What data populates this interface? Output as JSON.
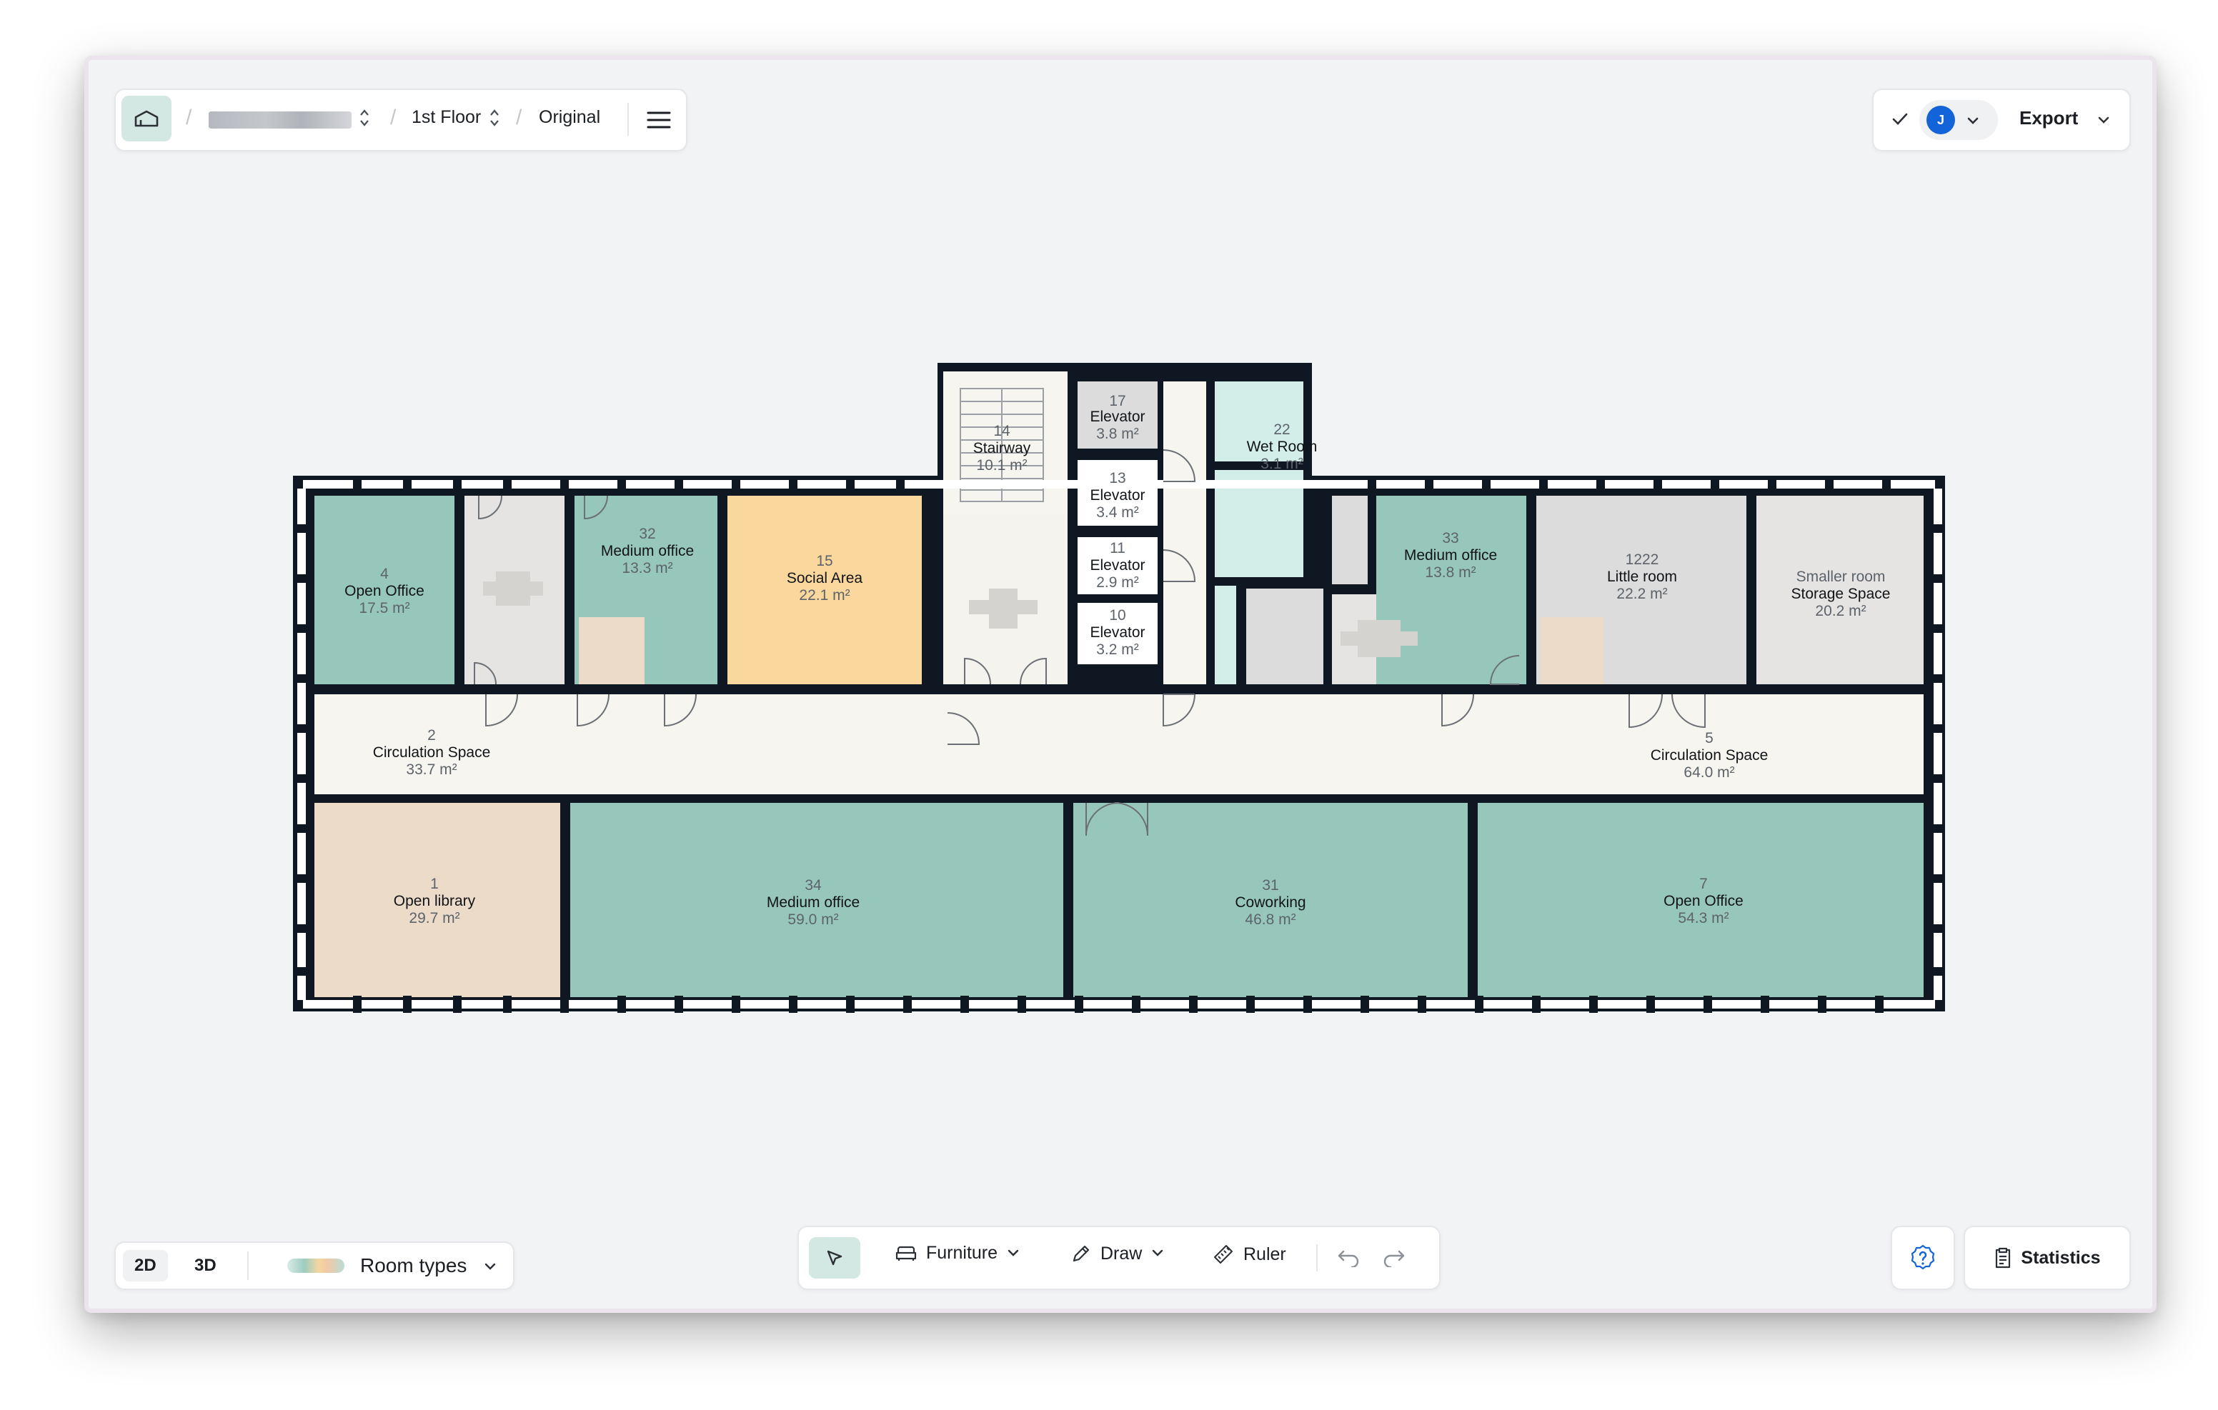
{
  "header": {
    "floor": "1st Floor",
    "version": "Original"
  },
  "account": {
    "avatar_initial": "J",
    "export_label": "Export"
  },
  "view": {
    "mode_2d": "2D",
    "mode_3d": "3D",
    "active_mode": "2D",
    "legend_label": "Room types"
  },
  "toolbar": {
    "furniture_label": "Furniture",
    "draw_label": "Draw",
    "ruler_label": "Ruler"
  },
  "statistics_label": "Statistics",
  "colors": {
    "office": "#97c7bb",
    "social": "#fad79c",
    "library": "#eddbc9",
    "circulation": "#f6f5ef",
    "storage": "#e5e4e2",
    "little_room": "#dcdcdc",
    "wet_room": "#d3ede9",
    "wall": "#0f1722",
    "accent": "#d3e8e2"
  },
  "rooms": [
    {
      "id": "4",
      "name": "4",
      "type": "Open Office",
      "area": "17.5 m²"
    },
    {
      "id": "32",
      "name": "32",
      "type": "Medium office",
      "area": "13.3 m²"
    },
    {
      "id": "15",
      "name": "15",
      "type": "Social Area",
      "area": "22.1 m²"
    },
    {
      "id": "14",
      "name": "14",
      "type": "Stairway",
      "area": "10.1 m²"
    },
    {
      "id": "17",
      "name": "17",
      "type": "Elevator",
      "area": "3.8 m²"
    },
    {
      "id": "13",
      "name": "13",
      "type": "Elevator",
      "area": "3.4 m²"
    },
    {
      "id": "11",
      "name": "11",
      "type": "Elevator",
      "area": "2.9 m²"
    },
    {
      "id": "10",
      "name": "10",
      "type": "Elevator",
      "area": "3.2 m²"
    },
    {
      "id": "22",
      "name": "22",
      "type": "Wet Room",
      "area": "3.1 m²"
    },
    {
      "id": "33",
      "name": "33",
      "type": "Medium office",
      "area": "13.8 m²"
    },
    {
      "id": "1222",
      "name": "1222",
      "type": "Little room",
      "area": "22.2 m²"
    },
    {
      "id": "smaller",
      "name": "Smaller room",
      "type": "Storage Space",
      "area": "20.2 m²"
    },
    {
      "id": "2",
      "name": "2",
      "type": "Circulation Space",
      "area": "33.7 m²"
    },
    {
      "id": "5",
      "name": "5",
      "type": "Circulation Space",
      "area": "64.0 m²"
    },
    {
      "id": "1",
      "name": "1",
      "type": "Open library",
      "area": "29.7 m²"
    },
    {
      "id": "34",
      "name": "34",
      "type": "Medium office",
      "area": "59.0 m²"
    },
    {
      "id": "31",
      "name": "31",
      "type": "Coworking",
      "area": "46.8 m²"
    },
    {
      "id": "7",
      "name": "7",
      "type": "Open Office",
      "area": "54.3 m²"
    }
  ]
}
